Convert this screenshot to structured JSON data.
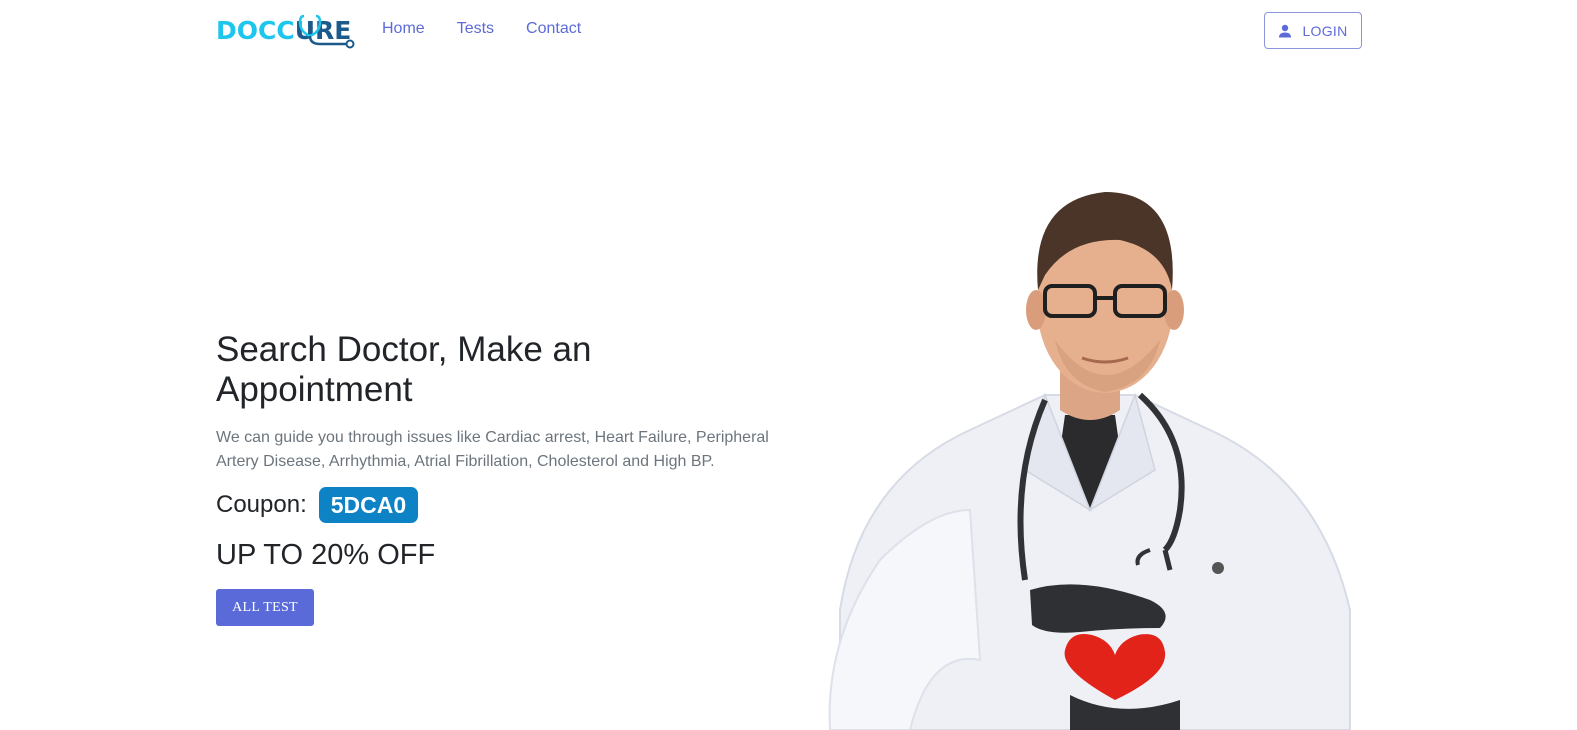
{
  "brand": {
    "logo_part1": "DOCC",
    "logo_part2": "URE",
    "doc_color": "#1ec6ee",
    "cure_color": "#1b5a8a"
  },
  "nav": {
    "items": [
      {
        "label": "Home"
      },
      {
        "label": "Tests"
      },
      {
        "label": "Contact"
      }
    ]
  },
  "header": {
    "login_label": "LOGIN",
    "login_icon": "user-icon"
  },
  "hero": {
    "title": "Search Doctor, Make an Appointment",
    "description": "We can guide you through issues like Cardiac arrest, Heart Failure, Peripheral Artery Disease, Arrhythmia, Atrial Fibrillation, Cholesterol and High BP.",
    "coupon_label": "Coupon:",
    "coupon_code": "5DCA0",
    "offer": "UP TO 20% OFF",
    "cta_label": "ALL TEST"
  },
  "colors": {
    "accent": "#5a6ad8",
    "coupon_bg": "#0d82c4"
  }
}
